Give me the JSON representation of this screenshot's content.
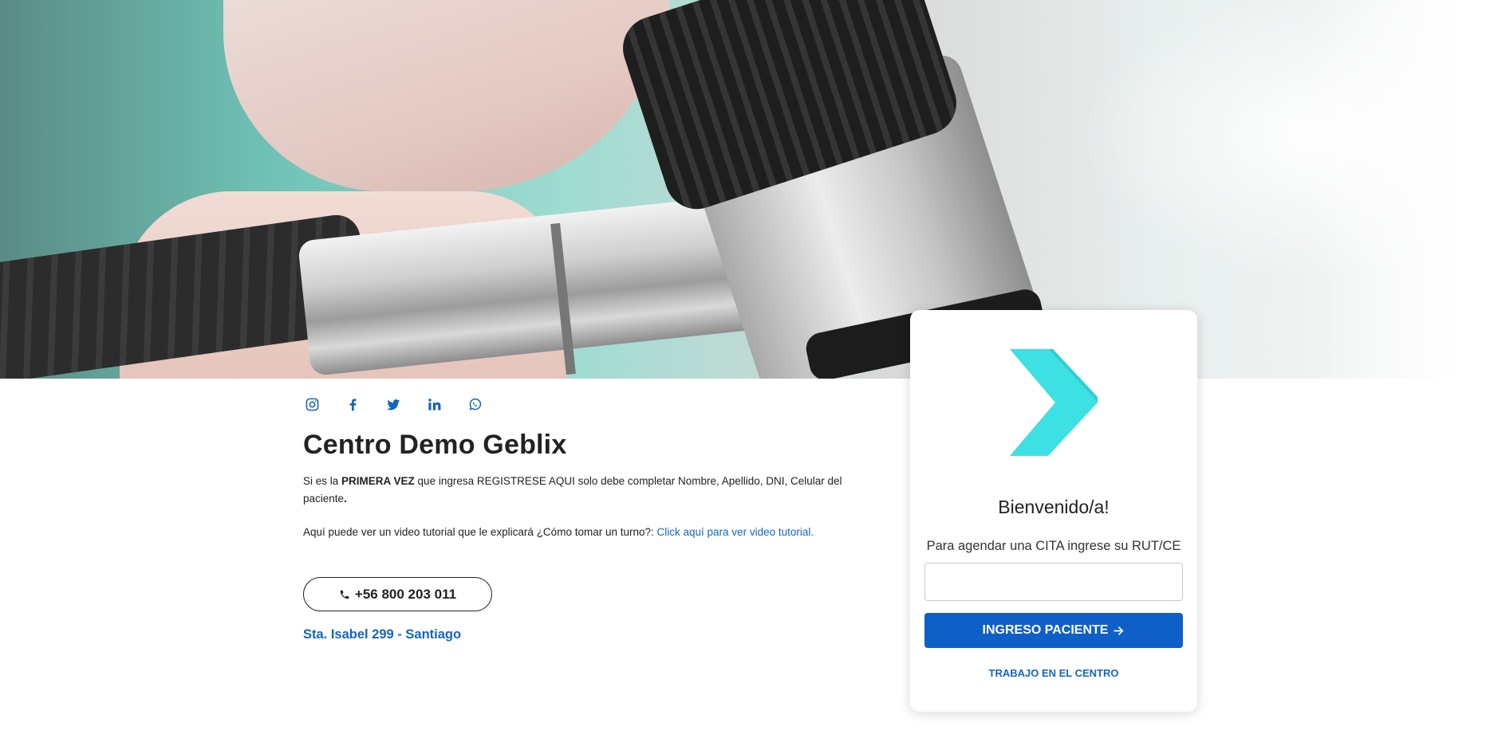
{
  "hero": {
    "image_icon": "otoscope-photo"
  },
  "social": [
    {
      "icon": "instagram-icon",
      "color": "#1565c0"
    },
    {
      "icon": "facebook-icon",
      "color": "#1565c0"
    },
    {
      "icon": "twitter-icon",
      "color": "#1565c0"
    },
    {
      "icon": "linkedin-icon",
      "color": "#1565c0"
    },
    {
      "icon": "whatsapp-icon",
      "color": "#1565c0"
    }
  ],
  "center": {
    "title": "Centro Demo Geblix",
    "intro_pre": "Si es la ",
    "intro_bold": "PRIMERA VEZ",
    "intro_post": " que ingresa  REGISTRESE AQUI solo debe completar Nombre, Apellido, DNI, Celular del paciente",
    "intro_end": ".",
    "tutorial_text": "Aquí puede ver un video tutorial que le explicará ¿Cómo tomar un turno?: ",
    "tutorial_link": "Click aquí para ver video tutorial.",
    "phone": "+56 800 203 011",
    "address": "Sta. Isabel 299 - Santiago"
  },
  "login": {
    "welcome": "Bienvenido/a!",
    "rut_label": "Para agendar una CITA ingrese su RUT/CE",
    "rut_value": "",
    "rut_placeholder": "",
    "submit_label": "INGRESO PACIENTE",
    "work_link": "TRABAJO EN EL CENTRO"
  },
  "colors": {
    "accent": "#0f5fc9",
    "link": "#1565c0",
    "logo": "#3de0e3"
  }
}
